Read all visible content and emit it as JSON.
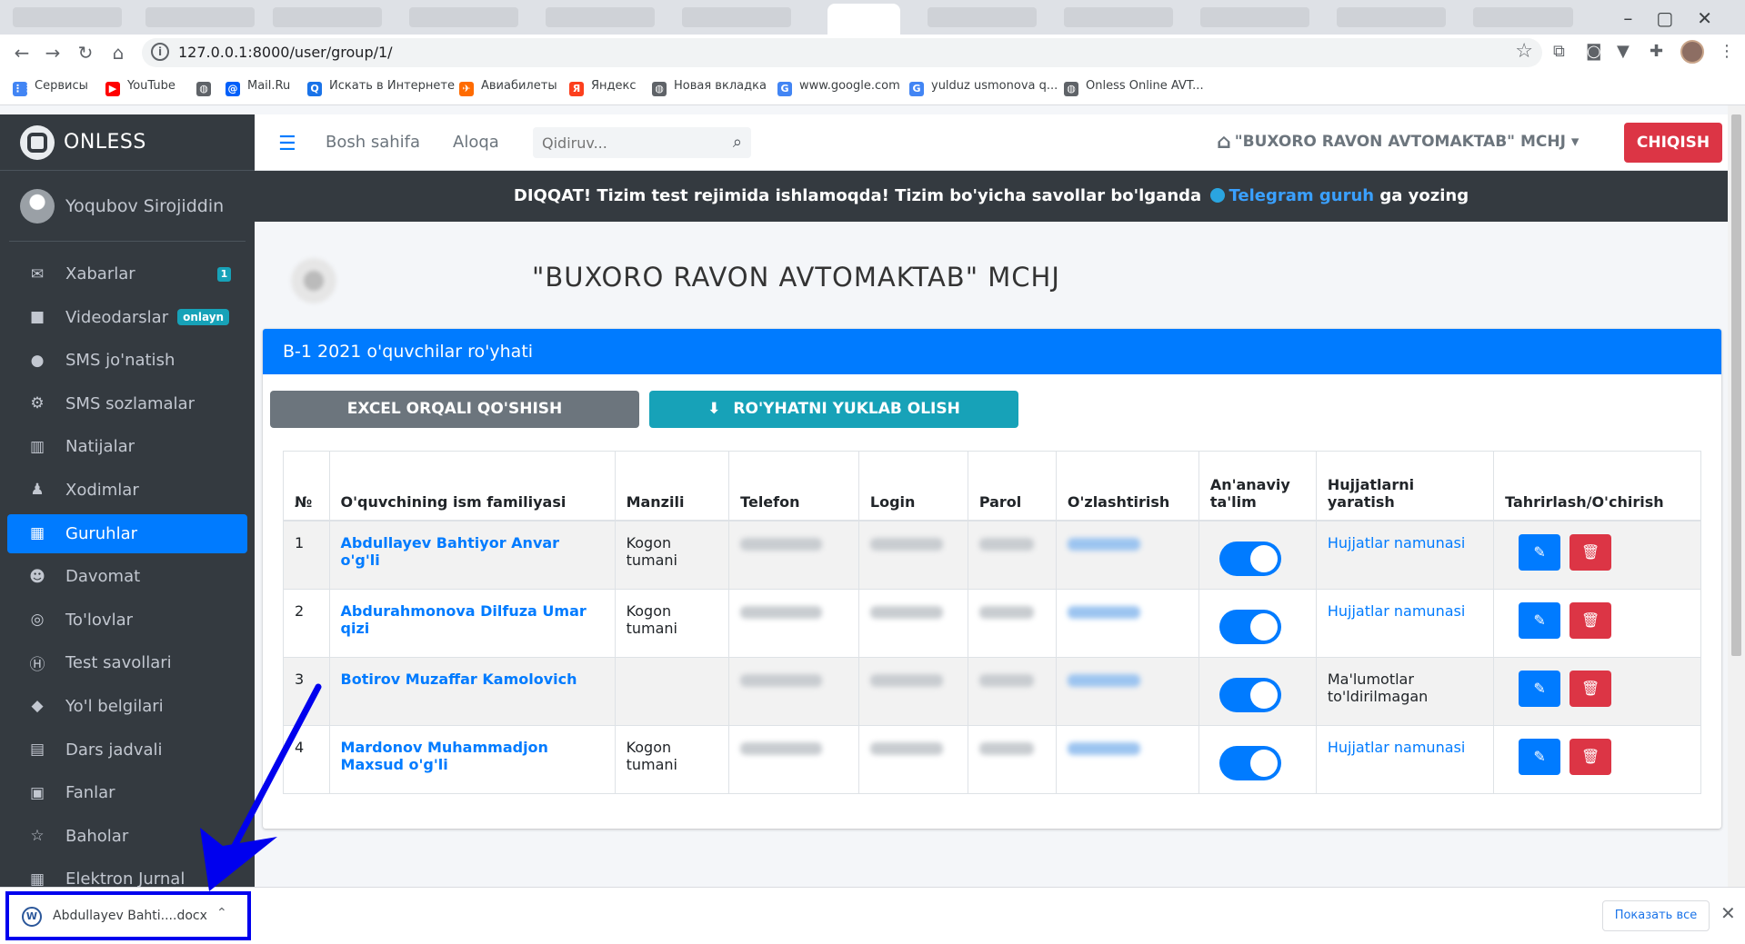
{
  "browser": {
    "url": "127.0.0.1:8000/user/group/1/",
    "bookmarks": [
      {
        "label": "Сервисы",
        "icon": "apps-grid-icon",
        "color": "#4285f4"
      },
      {
        "label": "YouTube",
        "icon": "youtube-icon",
        "color": "#ff0000"
      },
      {
        "label": "",
        "icon": "globe-icon",
        "color": "#5f6368"
      },
      {
        "label": "Mail.Ru",
        "icon": "mailru-icon",
        "color": "#005ff9"
      },
      {
        "label": "Искать в Интернете",
        "icon": "search-q-icon",
        "color": "#1a73e8"
      },
      {
        "label": "Авиабилеты",
        "icon": "plane-icon",
        "color": "#ff6b00"
      },
      {
        "label": "Яндекс",
        "icon": "yandex-icon",
        "color": "#fc3f1d"
      },
      {
        "label": "Новая вкладка",
        "icon": "globe-icon",
        "color": "#5f6368"
      },
      {
        "label": "www.google.com",
        "icon": "google-icon",
        "color": "#4285f4"
      },
      {
        "label": "yulduz usmonova q...",
        "icon": "google-icon",
        "color": "#4285f4"
      },
      {
        "label": "Onless Online AVT...",
        "icon": "globe-icon",
        "color": "#5f6368"
      }
    ]
  },
  "sidebar": {
    "brand": "ONLESS",
    "user": "Yoqubov Sirojiddin",
    "items": [
      {
        "label": "Xabarlar",
        "icon": "envelope-icon",
        "badge": "1"
      },
      {
        "label": "Videodarslar",
        "icon": "video-icon",
        "badge_text": "onlayn"
      },
      {
        "label": "SMS jo'natish",
        "icon": "sms-icon"
      },
      {
        "label": "SMS sozlamalar",
        "icon": "cogs-icon"
      },
      {
        "label": "Natijalar",
        "icon": "chart-icon"
      },
      {
        "label": "Xodimlar",
        "icon": "user-tie-icon"
      },
      {
        "label": "Guruhlar",
        "icon": "grid-icon",
        "active": true
      },
      {
        "label": "Davomat",
        "icon": "users-icon"
      },
      {
        "label": "To'lovlar",
        "icon": "coins-icon"
      },
      {
        "label": "Test savollari",
        "icon": "h-circle-icon"
      },
      {
        "label": "Yo'l belgilari",
        "icon": "road-sign-icon"
      },
      {
        "label": "Dars jadvali",
        "icon": "clipboard-icon"
      },
      {
        "label": "Fanlar",
        "icon": "book-icon"
      },
      {
        "label": "Baholar",
        "icon": "star-icon"
      },
      {
        "label": "Elektron Jurnal",
        "icon": "calendar-icon"
      }
    ]
  },
  "header": {
    "home": "Bosh sahifa",
    "contact": "Aloqa",
    "search_placeholder": "Qidiruv...",
    "company": "\"BUXORO RAVON AVTOMAKTAB\" MCHJ",
    "logout": "CHIQISH"
  },
  "alert": {
    "text_before": "DIQQAT! Tizim test rejimida ishlamoqda! Tizim bo'yicha savollar bo'lganda",
    "link": "Telegram guruh",
    "text_after": "ga yozing"
  },
  "content": {
    "title": "\"BUXORO RAVON AVTOMAKTAB\" MCHJ",
    "card_title": "B-1 2021 o'quvchilar ro'yhati",
    "btn_excel": "EXCEL ORQALI QO'SHISH",
    "btn_download": "RO'YHATNI YUKLAB OLISH"
  },
  "table": {
    "columns": [
      "№",
      "O'quvchining ism familiyasi",
      "Manzili",
      "Telefon",
      "Login",
      "Parol",
      "O'zlashtirish",
      "An'anaviy ta'lim",
      "Hujjatlarni yaratish",
      "Tahrirlash/O'chirish"
    ],
    "rows": [
      {
        "n": "1",
        "name": "Abdullayev Bahtiyor Anvar o'g'li",
        "address": "Kogon tumani",
        "doc": "Hujjatlar namunasi",
        "doc_is_link": true
      },
      {
        "n": "2",
        "name": "Abdurahmonova Dilfuza Umar qizi",
        "address": "Kogon tumani",
        "doc": "Hujjatlar namunasi",
        "doc_is_link": true
      },
      {
        "n": "3",
        "name": "Botirov Muzaffar Kamolovich",
        "address": "",
        "doc": "Ma'lumotlar to'ldirilmagan",
        "doc_is_link": false
      },
      {
        "n": "4",
        "name": "Mardonov Muhammadjon Maxsud o'g'li",
        "address": "Kogon tumani",
        "doc": "Hujjatlar namunasi",
        "doc_is_link": true
      }
    ]
  },
  "downloads": {
    "file": "Abdullayev Bahti....docx",
    "show_all": "Показать все"
  }
}
